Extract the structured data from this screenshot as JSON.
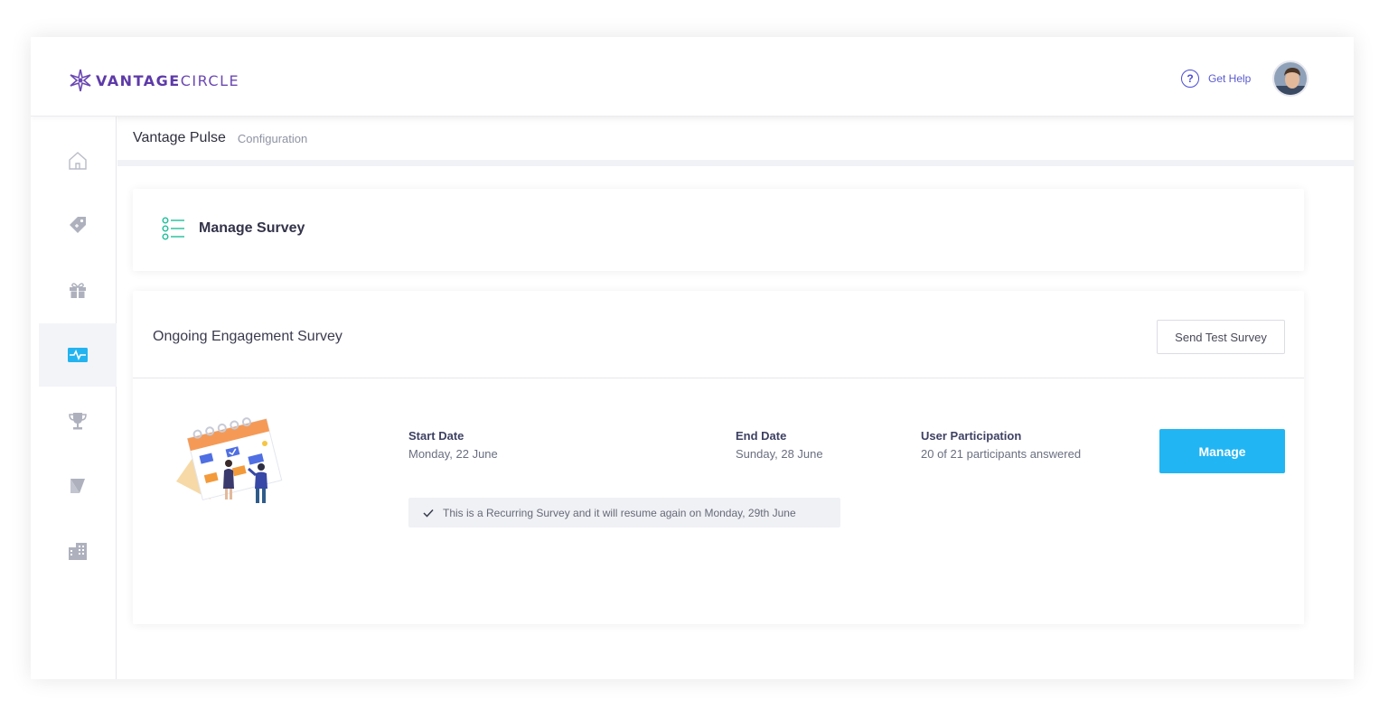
{
  "brand": {
    "logo_bold": "VANTAGE",
    "logo_light": "CIRCLE",
    "accent": "#5d3aa8"
  },
  "header": {
    "help_label": "Get Help",
    "help_icon": "question-circle-icon"
  },
  "sidebar": {
    "items": [
      {
        "icon": "home-icon"
      },
      {
        "icon": "tag-icon"
      },
      {
        "icon": "gift-icon"
      },
      {
        "icon": "pulse-icon",
        "active": true
      },
      {
        "icon": "trophy-icon"
      },
      {
        "icon": "compass-icon"
      },
      {
        "icon": "buildings-icon"
      }
    ]
  },
  "breadcrumb": {
    "main": "Vantage Pulse",
    "sub": "Configuration"
  },
  "manage_card": {
    "title": "Manage Survey",
    "icon": "list-icon"
  },
  "survey": {
    "name": "Ongoing Engagement Survey",
    "test_button": "Send Test Survey",
    "start_label": "Start Date",
    "start_value": "Monday, 22 June",
    "end_label": "End Date",
    "end_value": "Sunday, 28 June",
    "participation_label": "User Participation",
    "participation_value": "20 of 21 participants answered",
    "manage_button": "Manage",
    "recurring_note": "This is a Recurring Survey and it will resume again on Monday, 29th June",
    "button_color": "#22b5f3"
  }
}
